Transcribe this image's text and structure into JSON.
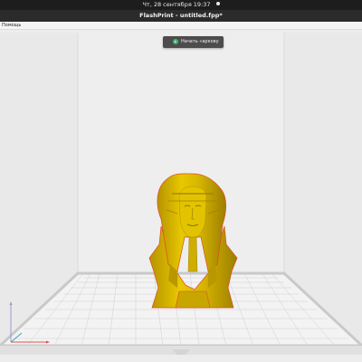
{
  "system_bar": {
    "datetime": "Чт, 28 сентября  19:37"
  },
  "window": {
    "title": "FlashPrint - untitled.fpp*"
  },
  "menu": {
    "items": [
      {
        "label": "Помощь"
      }
    ]
  },
  "toolbar": {
    "start_print_label": "Начать «аркову",
    "start_print_icon": "play-circle-icon"
  },
  "viewport": {
    "model": {
      "name": "pharaoh-bust",
      "color": "#d9b800"
    },
    "axes_colors": {
      "x": "#e05050",
      "y": "#3aa0c8",
      "z": "#9a9ad0"
    }
  }
}
